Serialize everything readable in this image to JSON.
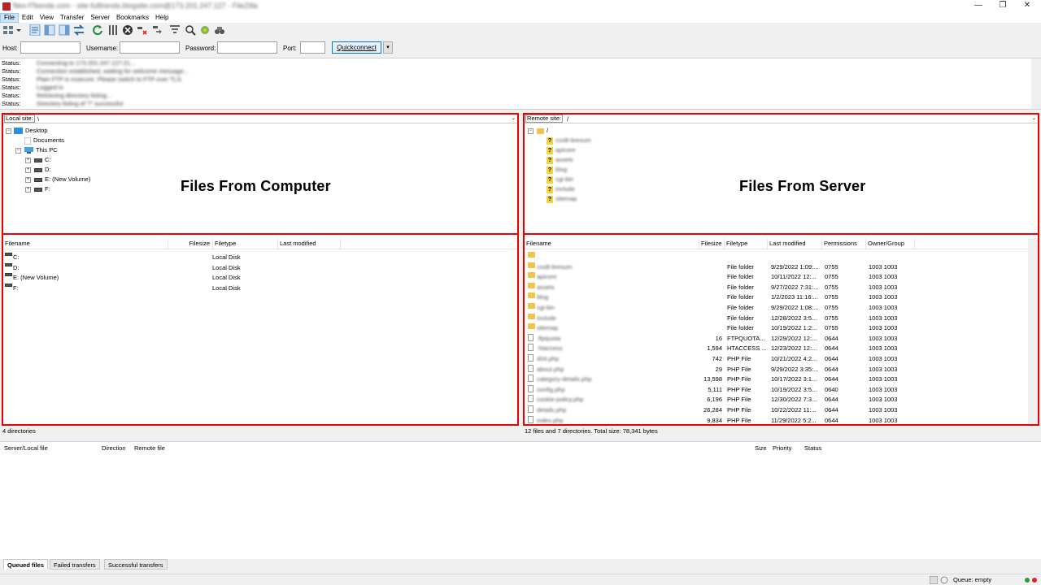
{
  "window": {
    "title": "files-f7kende.com - site-fulltrends.blogsite.com@173.201.247.127 - FileZilla",
    "minimize": "—",
    "maximize": "❐",
    "close": "✕"
  },
  "menu": [
    "File",
    "Edit",
    "View",
    "Transfer",
    "Server",
    "Bookmarks",
    "Help"
  ],
  "quickconnect": {
    "host_label": "Host:",
    "username_label": "Username:",
    "password_label": "Password:",
    "port_label": "Port:",
    "button": "Quickconnect",
    "drop": "▾",
    "host": "",
    "username": "",
    "password": "",
    "port": ""
  },
  "log": [
    {
      "label": "Status:",
      "text": "Connecting to 173.201.247.127:21..."
    },
    {
      "label": "Status:",
      "text": "Connection established, waiting for welcome message..."
    },
    {
      "label": "Status:",
      "text": "Plain FTP is insecure. Please switch to FTP over TLS."
    },
    {
      "label": "Status:",
      "text": "Logged in"
    },
    {
      "label": "Status:",
      "text": "Retrieving directory listing..."
    },
    {
      "label": "Status:",
      "text": "Directory listing of \"/\" successful"
    }
  ],
  "local": {
    "site_label": "Local site:",
    "path": "\\",
    "caption": "Files From Computer",
    "tree": [
      {
        "label": "Desktop"
      },
      {
        "label": "Documents"
      },
      {
        "label": "This PC"
      },
      {
        "label": "C:"
      },
      {
        "label": "D:"
      },
      {
        "label": "E: (New Volume)"
      },
      {
        "label": "F:"
      }
    ],
    "columns": [
      "Filename",
      "Filesize",
      "Filetype",
      "Last modified"
    ],
    "files": [
      {
        "name": "C:",
        "type": "Local Disk"
      },
      {
        "name": "D:",
        "type": "Local Disk"
      },
      {
        "name": "E: (New Volume)",
        "type": "Local Disk"
      },
      {
        "name": "F:",
        "type": "Local Disk"
      }
    ],
    "status": "4 directories"
  },
  "remote": {
    "site_label": "Remote site:",
    "path": "/",
    "caption": "Files From Server",
    "tree_root": "/",
    "tree": [
      "cssB-bresum",
      "apicore",
      "assets",
      "blog",
      "cgi-bin",
      "include",
      "sitemap"
    ],
    "columns": [
      "Filename",
      "Filesize",
      "Filetype",
      "Last modified",
      "Permissions",
      "Owner/Group"
    ],
    "files": [
      {
        "name": "..",
        "size": "",
        "type": "",
        "modified": "",
        "perms": "",
        "owner": "",
        "kind": "folder"
      },
      {
        "name": "cssB-bresum",
        "size": "",
        "type": "File folder",
        "modified": "9/29/2022 1:09:...",
        "perms": "0755",
        "owner": "1003 1003",
        "kind": "folder"
      },
      {
        "name": "apicore",
        "size": "",
        "type": "File folder",
        "modified": "10/11/2022 12:...",
        "perms": "0755",
        "owner": "1003 1003",
        "kind": "folder"
      },
      {
        "name": "assets",
        "size": "",
        "type": "File folder",
        "modified": "9/27/2022 7:31:...",
        "perms": "0755",
        "owner": "1003 1003",
        "kind": "folder"
      },
      {
        "name": "blog",
        "size": "",
        "type": "File folder",
        "modified": "1/2/2023 11:16:...",
        "perms": "0755",
        "owner": "1003 1003",
        "kind": "folder"
      },
      {
        "name": "cgi-bin",
        "size": "",
        "type": "File folder",
        "modified": "9/29/2022 1:08:...",
        "perms": "0755",
        "owner": "1003 1003",
        "kind": "folder"
      },
      {
        "name": "include",
        "size": "",
        "type": "File folder",
        "modified": "12/28/2022 3:5...",
        "perms": "0755",
        "owner": "1003 1003",
        "kind": "folder"
      },
      {
        "name": "sitemap",
        "size": "",
        "type": "File folder",
        "modified": "10/19/2022 1:2...",
        "perms": "0755",
        "owner": "1003 1003",
        "kind": "folder"
      },
      {
        "name": ".ftpquota",
        "size": "16",
        "type": "FTPQUOTA...",
        "modified": "12/29/2022 12:...",
        "perms": "0644",
        "owner": "1003 1003",
        "kind": "file"
      },
      {
        "name": ".htaccess",
        "size": "1,594",
        "type": "HTACCESS ...",
        "modified": "12/23/2022 12:...",
        "perms": "0644",
        "owner": "1003 1003",
        "kind": "file"
      },
      {
        "name": "404.php",
        "size": "742",
        "type": "PHP File",
        "modified": "10/21/2022 4:2...",
        "perms": "0644",
        "owner": "1003 1003",
        "kind": "file"
      },
      {
        "name": "about.php",
        "size": "29",
        "type": "PHP File",
        "modified": "9/29/2022 3:35:...",
        "perms": "0644",
        "owner": "1003 1003",
        "kind": "file"
      },
      {
        "name": "category-details.php",
        "size": "13,598",
        "type": "PHP File",
        "modified": "10/17/2022 3:1...",
        "perms": "0644",
        "owner": "1003 1003",
        "kind": "file"
      },
      {
        "name": "config.php",
        "size": "5,111",
        "type": "PHP File",
        "modified": "10/19/2022 3:5...",
        "perms": "0640",
        "owner": "1003 1003",
        "kind": "file"
      },
      {
        "name": "cookie-policy.php",
        "size": "6,196",
        "type": "PHP File",
        "modified": "12/30/2022 7:3...",
        "perms": "0644",
        "owner": "1003 1003",
        "kind": "file"
      },
      {
        "name": "details.php",
        "size": "26,284",
        "type": "PHP File",
        "modified": "10/22/2022 11:...",
        "perms": "0644",
        "owner": "1003 1003",
        "kind": "file"
      },
      {
        "name": "index.php",
        "size": "9,834",
        "type": "PHP File",
        "modified": "11/29/2022 5:2...",
        "perms": "0644",
        "owner": "1003 1003",
        "kind": "file"
      }
    ],
    "status": "12 files and 7 directories. Total size: 78,341 bytes"
  },
  "queue": {
    "columns": [
      "Server/Local file",
      "Direction",
      "Remote file",
      "Size",
      "Priority",
      "Status"
    ],
    "tabs": [
      "Queued files",
      "Failed transfers",
      "Successful transfers"
    ],
    "status": "Queue: empty"
  },
  "colors": {
    "highlight": "#e00000",
    "folder": "#f3c24a",
    "accent": "#0078d7"
  }
}
